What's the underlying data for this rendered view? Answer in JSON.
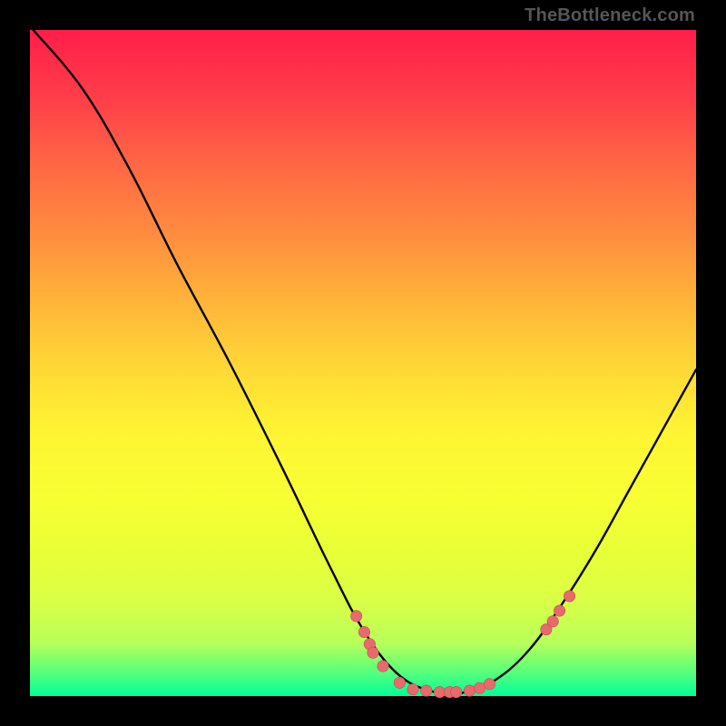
{
  "attribution": "TheBottleneck.com",
  "chart_data": {
    "type": "line",
    "title": "",
    "xlabel": "",
    "ylabel": "",
    "xlim": [
      0,
      100
    ],
    "ylim": [
      0,
      100
    ],
    "curve_points": [
      {
        "x": 0.5,
        "y": 100
      },
      {
        "x": 8,
        "y": 91
      },
      {
        "x": 15,
        "y": 79
      },
      {
        "x": 22,
        "y": 65
      },
      {
        "x": 30,
        "y": 50
      },
      {
        "x": 38,
        "y": 34
      },
      {
        "x": 45,
        "y": 19.5
      },
      {
        "x": 50,
        "y": 10
      },
      {
        "x": 55,
        "y": 3.5
      },
      {
        "x": 60,
        "y": 0.8
      },
      {
        "x": 65,
        "y": 0.5
      },
      {
        "x": 70,
        "y": 2.5
      },
      {
        "x": 75,
        "y": 7
      },
      {
        "x": 80,
        "y": 14
      },
      {
        "x": 85,
        "y": 22
      },
      {
        "x": 90,
        "y": 31
      },
      {
        "x": 95,
        "y": 40
      },
      {
        "x": 100,
        "y": 49
      }
    ],
    "dots": [
      {
        "x": 49.0,
        "y": 12.0
      },
      {
        "x": 50.2,
        "y": 9.6
      },
      {
        "x": 51.0,
        "y": 7.8
      },
      {
        "x": 51.5,
        "y": 6.5
      },
      {
        "x": 53.0,
        "y": 4.5
      },
      {
        "x": 55.5,
        "y": 2.0
      },
      {
        "x": 57.5,
        "y": 1.0
      },
      {
        "x": 59.5,
        "y": 0.8
      },
      {
        "x": 61.5,
        "y": 0.6
      },
      {
        "x": 63.0,
        "y": 0.6
      },
      {
        "x": 64.0,
        "y": 0.6
      },
      {
        "x": 66.0,
        "y": 0.8
      },
      {
        "x": 67.5,
        "y": 1.2
      },
      {
        "x": 69.0,
        "y": 1.8
      },
      {
        "x": 77.5,
        "y": 10.0
      },
      {
        "x": 78.5,
        "y": 11.2
      },
      {
        "x": 79.5,
        "y": 12.8
      },
      {
        "x": 81.0,
        "y": 15.0
      }
    ],
    "colors": {
      "curve": "#000000",
      "dot_fill": "#e86a6e",
      "dot_stroke": "#c74a4e"
    }
  }
}
